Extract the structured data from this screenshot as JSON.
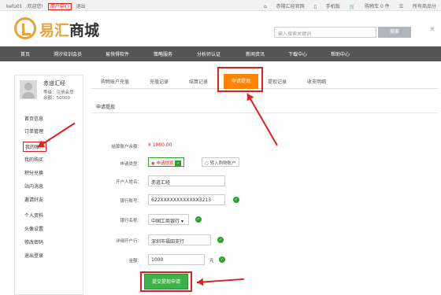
{
  "topbar": {
    "user": "kefu01",
    "welcome": "欢迎您!",
    "user_center": "用户中心",
    "logout": "退出",
    "site": "赤隨汇经官网",
    "mobile": "手机版",
    "cart": "购物车 0 件",
    "categories": "所有商品分"
  },
  "logo": {
    "part1": "易汇",
    "part2": "商城"
  },
  "search": {
    "placeholder": "输入搜索关键词",
    "button": "搜索"
  },
  "close": "关",
  "nav": [
    "首页",
    "溯汐培训会员",
    "易快得软件",
    "策略服务",
    "分析师认证",
    "新闻资讯",
    "下载中心",
    "帮助中心"
  ],
  "account": {
    "name": "赤道汇经",
    "level": "等级：注册会员",
    "balance": "余额：50000",
    "menu": [
      "首页信息",
      "订单管理",
      "我的账户",
      "我的购买",
      "积分兑换",
      "站内消息",
      "邀请好友",
      "个人资料",
      "头像设置",
      "修改密码",
      "退出登录"
    ]
  },
  "tabs": [
    "购物账户充值",
    "充值记录",
    "结算记录",
    "申请提现",
    "提现记录",
    "收支明细"
  ],
  "form": {
    "title": "申请提现",
    "balance_label": "结算账户余额：",
    "balance_value": "¥ 1000.00",
    "type_label": "申请类型：",
    "type_option1": "申请提现",
    "type_option2": "转入购物账户",
    "holder_label": "开户人姓名：",
    "holder_value": "赤道汇经",
    "account_label": "银行账号：",
    "account_value": "622XXXXXXXXXXXX3213",
    "bank_label": "银行名称：",
    "bank_value": "中国工商银行",
    "branch_label": "详细开户行：",
    "branch_value": "深圳市福田支行",
    "amount_label": "金额：",
    "amount_value": "1000",
    "amount_unit": "元",
    "submit": "提交提现申请"
  },
  "colors": {
    "accent": "#ff8200",
    "annotation": "#e02020",
    "success": "#3eb24a"
  }
}
